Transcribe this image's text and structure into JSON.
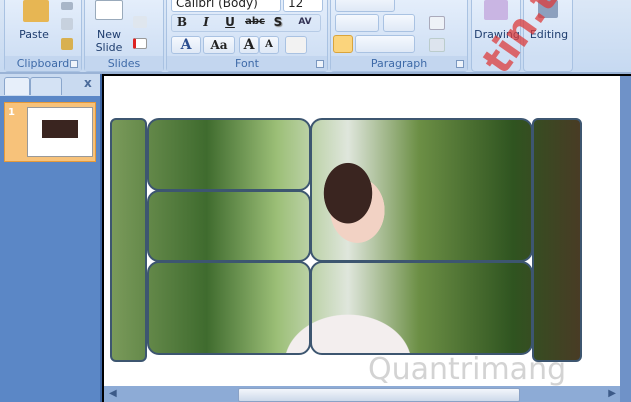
{
  "ribbon": {
    "font_name": "Calibri (Body)",
    "font_size": "12",
    "groups": {
      "clipboard": "Clipboard",
      "slides": "Slides",
      "font": "Font",
      "paragraph": "Paragraph"
    },
    "paste": "Paste",
    "new_slide": "New Slide",
    "drawing": "Drawing",
    "editing": "Editing",
    "font_buttons": [
      "B",
      "I",
      "U",
      "abc",
      "S",
      "AV",
      "A",
      "Aa",
      "A",
      "A"
    ]
  },
  "slides_pane": {
    "close": "x",
    "slide_number": "1"
  },
  "watermarks": [
    "tin.top",
    "Quantrimang"
  ],
  "colors": {
    "ribbon": "#c6d9f1",
    "pane": "#5b87c6",
    "selection": "#f7c27a"
  }
}
